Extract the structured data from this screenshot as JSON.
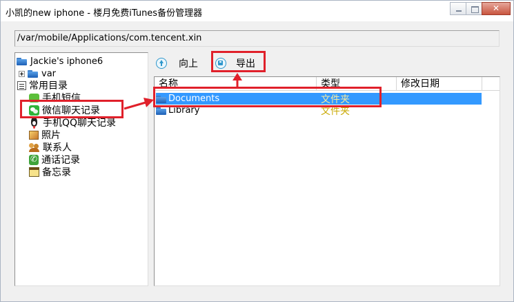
{
  "window": {
    "title": "小凯的new iphone - 楼月免费iTunes备份管理器"
  },
  "path_bar": {
    "value": "/var/mobile/Applications/com.tencent.xin"
  },
  "tree": {
    "root_label": "Jackie's iphone6",
    "var_label": "var",
    "common_label": "常用目录",
    "items": [
      {
        "label": "手机短信",
        "icon": "sms-icon"
      },
      {
        "label": "微信聊天记录",
        "icon": "wechat-icon"
      },
      {
        "label": "手机QQ聊天记录",
        "icon": "qq-icon"
      },
      {
        "label": "照片",
        "icon": "photo-icon"
      },
      {
        "label": "联系人",
        "icon": "contacts-icon"
      },
      {
        "label": "通话记录",
        "icon": "phone-icon"
      },
      {
        "label": "备忘录",
        "icon": "memo-icon"
      }
    ]
  },
  "toolbar": {
    "up_label": "向上",
    "export_label": "导出"
  },
  "file_list": {
    "columns": [
      "名称",
      "类型",
      "修改日期"
    ],
    "rows": [
      {
        "name": "Documents",
        "type": "文件夹",
        "modified": "",
        "selected": true
      },
      {
        "name": "Library",
        "type": "文件夹",
        "modified": "",
        "selected": false
      }
    ]
  },
  "colors": {
    "annotation": "#e0202a",
    "selection": "#3399ff",
    "folder_type_text": "#c9a800"
  }
}
